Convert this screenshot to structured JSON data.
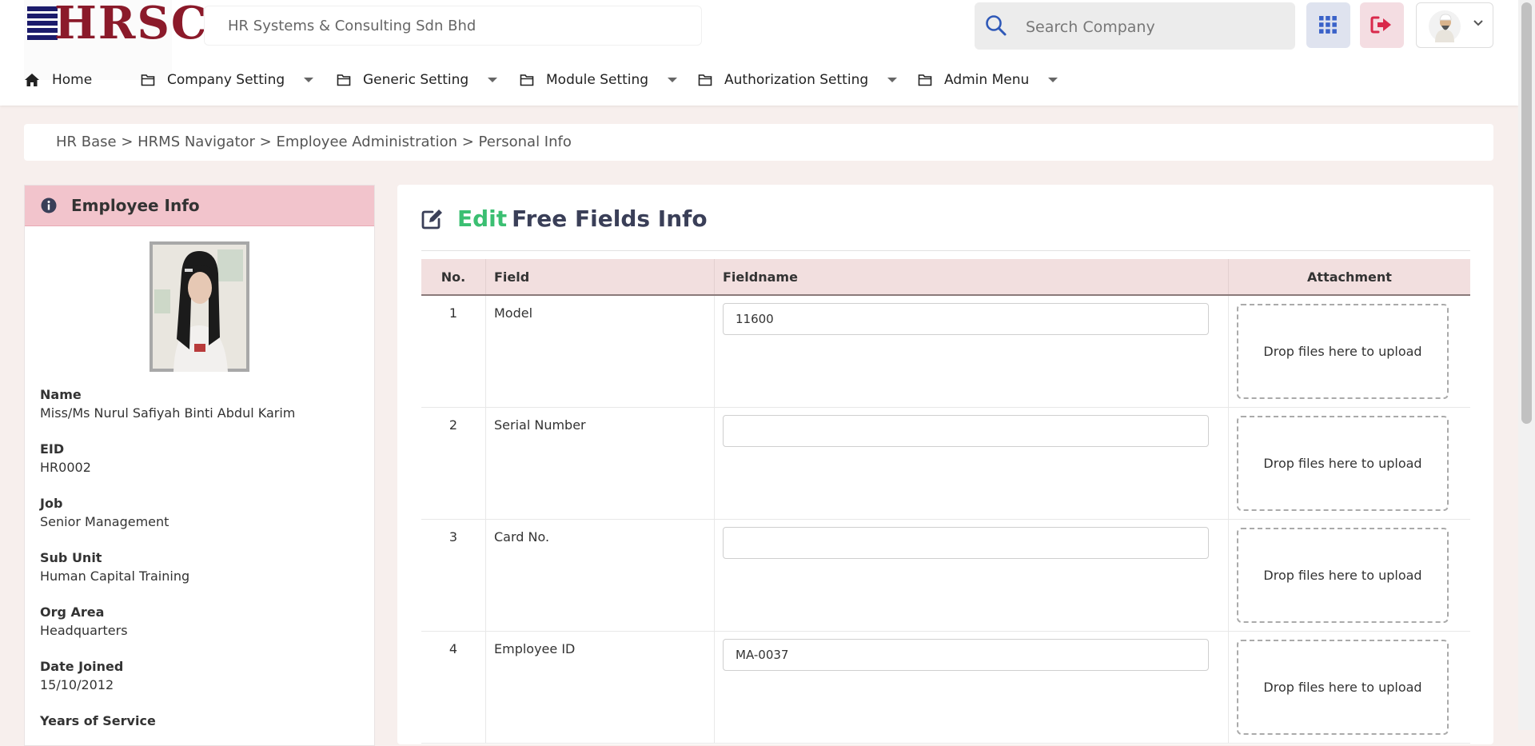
{
  "header": {
    "logo_text": "HRSC",
    "company_name": "HR Systems & Consulting Sdn Bhd",
    "search_placeholder": "Search Company",
    "icons": {
      "search": "search-icon",
      "apps": "grid-icon",
      "logout": "logout-icon",
      "user": "avatar",
      "dropdown": "chevron-down-icon"
    },
    "colors": {
      "logo": "#8b1a2a",
      "apps_bg": "#dfe3ef",
      "logout_bg": "#f4dde2",
      "logout_icon": "#d9294b",
      "apps_icon": "#3a62c9"
    }
  },
  "nav": {
    "items": [
      {
        "label": "Home",
        "icon": "home-icon"
      },
      {
        "label": "Company Setting",
        "icon": "folder-icon",
        "dropdown": true
      },
      {
        "label": "Generic Setting",
        "icon": "folder-icon",
        "dropdown": true
      },
      {
        "label": "Module Setting",
        "icon": "folder-icon",
        "dropdown": true
      },
      {
        "label": "Authorization Setting",
        "icon": "folder-icon",
        "dropdown": true
      },
      {
        "label": "Admin Menu",
        "icon": "folder-icon",
        "dropdown": true
      }
    ]
  },
  "breadcrumb": "HR Base > HRMS Navigator > Employee Administration > Personal Info",
  "employee": {
    "panel_title": "Employee Info",
    "fields": [
      {
        "label": "Name",
        "value": "Miss/Ms Nurul Safiyah Binti Abdul Karim"
      },
      {
        "label": "EID",
        "value": "HR0002"
      },
      {
        "label": "Job",
        "value": "Senior Management"
      },
      {
        "label": "Sub Unit",
        "value": "Human Capital Training"
      },
      {
        "label": "Org Area",
        "value": "Headquarters"
      },
      {
        "label": "Date Joined",
        "value": "15/10/2012"
      },
      {
        "label": "Years of Service",
        "value": ""
      }
    ]
  },
  "main": {
    "title_edit": "Edit",
    "title_rest": "Free Fields Info",
    "table": {
      "headers": {
        "no": "No.",
        "field": "Field",
        "fieldname": "Fieldname",
        "attachment": "Attachment"
      },
      "rows": [
        {
          "no": "1",
          "field": "Model",
          "value": "11600",
          "attachment": "Drop files here to upload"
        },
        {
          "no": "2",
          "field": "Serial Number",
          "value": "",
          "attachment": "Drop files here to upload"
        },
        {
          "no": "3",
          "field": "Card No.",
          "value": "",
          "attachment": "Drop files here to upload"
        },
        {
          "no": "4",
          "field": "Employee ID",
          "value": "MA-0037",
          "attachment": "Drop files here to upload"
        }
      ]
    },
    "colors": {
      "edit": "#3bbf72",
      "header_bg": "#f2dfdf"
    }
  }
}
